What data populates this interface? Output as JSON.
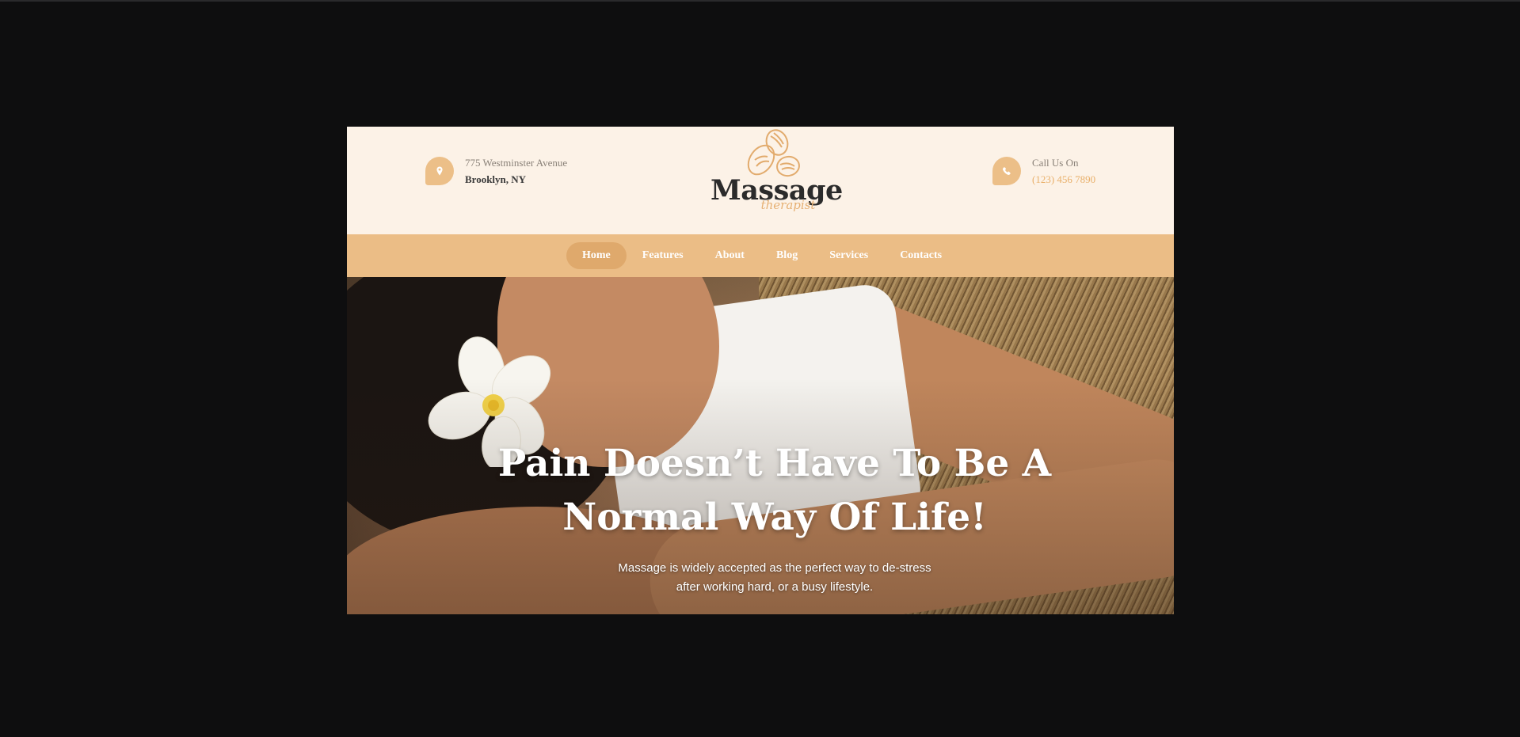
{
  "header": {
    "address": {
      "icon": "map-pin-icon",
      "line1": "775 Westminster Avenue",
      "line2": "Brooklyn, NY"
    },
    "logo": {
      "icon": "massage-stones-icon",
      "title": "Massage",
      "subtitle": "therapist"
    },
    "phone": {
      "icon": "phone-icon",
      "line1": "Call Us On",
      "line2": "(123) 456 7890"
    }
  },
  "nav": {
    "items": [
      {
        "label": "Home",
        "active": true
      },
      {
        "label": "Features",
        "active": false
      },
      {
        "label": "About",
        "active": false
      },
      {
        "label": "Blog",
        "active": false
      },
      {
        "label": "Services",
        "active": false
      },
      {
        "label": "Contacts",
        "active": false
      }
    ]
  },
  "hero": {
    "title_line1": "Pain Doesn’t Have To Be A",
    "title_line2": "Normal Way Of Life!",
    "subtitle_line1": "Massage is widely accepted as the perfect way to de-stress",
    "subtitle_line2": "after working hard, or a busy lifestyle."
  },
  "colors": {
    "page_background": "#0e0e0f",
    "header_background": "#fcf2e7",
    "accent": "#ebbd86",
    "accent_active": "#dfa96c",
    "text_dark": "#2b2b2b"
  }
}
